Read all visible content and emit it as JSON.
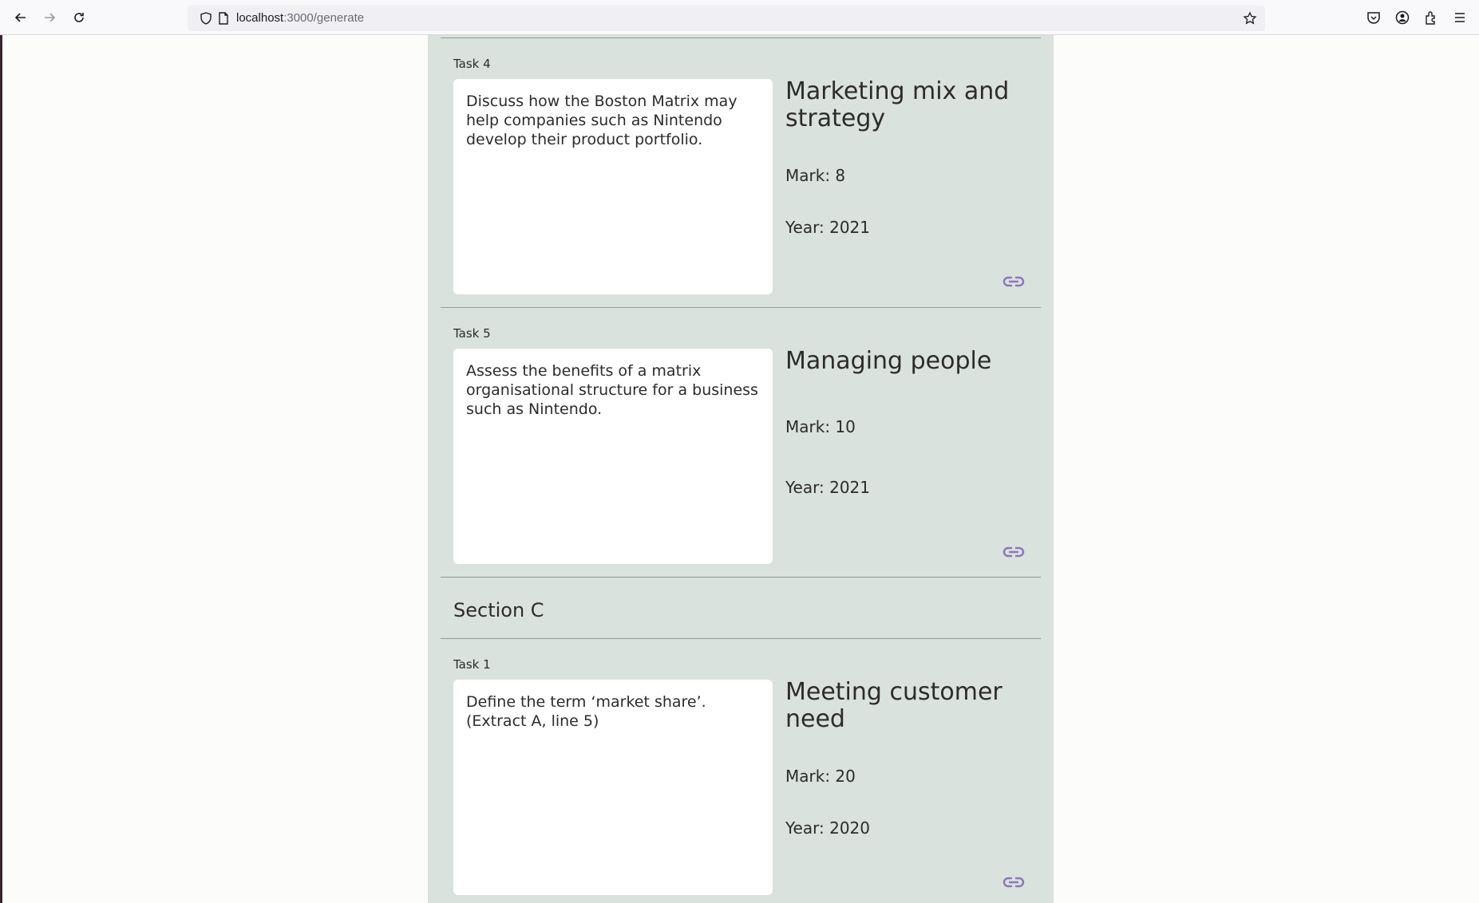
{
  "browser": {
    "url_host": "localhost",
    "url_path": ":3000/generate"
  },
  "tasks_before": [
    {
      "label": "Task 4",
      "question": "Discuss how the Boston Matrix may help companies such as Nintendo develop their product portfolio.",
      "topic": "Marketing mix and strategy",
      "mark": "Mark: 8",
      "year": "Year: 2021"
    },
    {
      "label": "Task 5",
      "question": "Assess the benefits of a matrix organisational structure for a business such as Nintendo.",
      "topic": "Managing people",
      "mark": "Mark: 10",
      "year": "Year: 2021"
    }
  ],
  "section_c": {
    "title": "Section C",
    "tasks": [
      {
        "label": "Task 1",
        "question": "Define the term ‘market share’. (Extract A, line 5)",
        "topic": "Meeting customer need",
        "mark": "Mark: 20",
        "year": "Year: 2020"
      }
    ]
  }
}
